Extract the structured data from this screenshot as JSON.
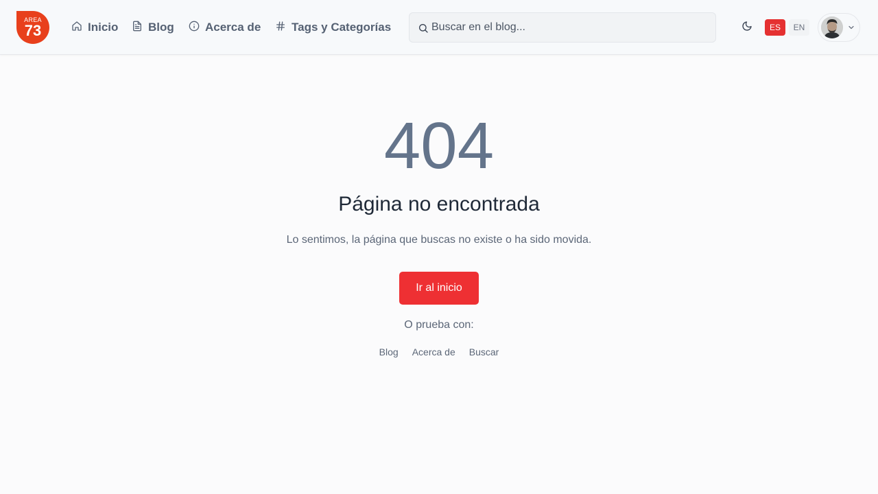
{
  "logo": {
    "top": "AREA",
    "number": "73",
    "color": "#e8401c"
  },
  "nav": [
    {
      "label": "Inicio",
      "icon": "home-icon"
    },
    {
      "label": "Blog",
      "icon": "document-icon"
    },
    {
      "label": "Acerca de",
      "icon": "info-icon"
    },
    {
      "label": "Tags y Categorías",
      "icon": "hash-icon"
    }
  ],
  "search": {
    "placeholder": "Buscar en el blog..."
  },
  "theme_toggle": {
    "icon": "moon-icon"
  },
  "languages": [
    {
      "label": "ES",
      "active": true
    },
    {
      "label": "EN",
      "active": false
    }
  ],
  "user_menu": {
    "icon": "chevron-down-icon"
  },
  "error": {
    "code": "404",
    "title": "Página no encontrada",
    "description": "Lo sentimos, la página que buscas no existe o ha sido movida.",
    "home_button": "Ir al inicio",
    "try_label": "O prueba con:",
    "links": [
      "Blog",
      "Acerca de",
      "Buscar"
    ]
  },
  "colors": {
    "accent": "#ee3033",
    "text_muted": "#5b6677",
    "code": "#64748b"
  }
}
